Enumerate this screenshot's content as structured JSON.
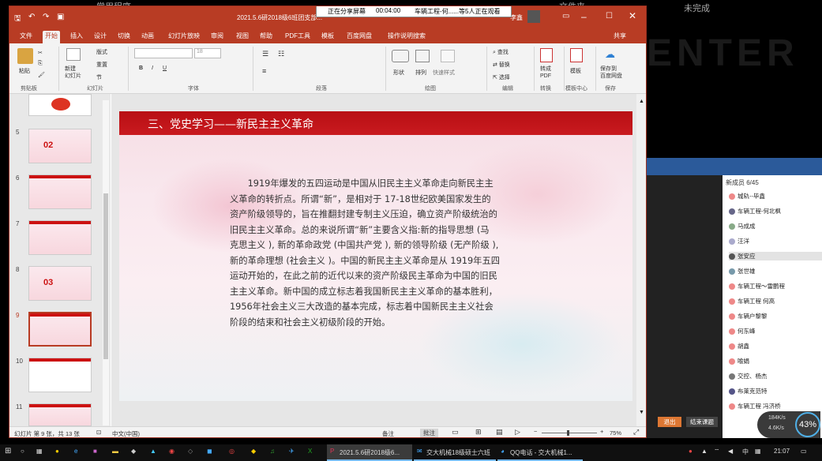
{
  "background": {
    "left_text": "常用程序",
    "mid_text": "文件夹",
    "right_text": "未完成",
    "bg_big": "ENTER"
  },
  "share_bar": {
    "sharing": "正在分享屏幕",
    "time": "00:04:00",
    "viewers": "车辆工程-何......等5人正在观看"
  },
  "ppt": {
    "title": "2021.5.6研2018级6班团支部...",
    "user": "李鑫",
    "tabs": [
      "文件",
      "开始",
      "插入",
      "设计",
      "切换",
      "动画",
      "幻灯片放映",
      "审阅",
      "视图",
      "帮助",
      "PDF工具",
      "模板",
      "百度网盘",
      "操作说明搜索",
      "共享"
    ],
    "ribbon": {
      "paste": "粘贴",
      "new_slide": "新建\n幻灯片",
      "layout": "版式",
      "reset": "重置",
      "section": "节",
      "font_size": "18",
      "groups": [
        "剪贴板",
        "幻灯片",
        "字体",
        "段落",
        "绘图",
        "编辑",
        "转换",
        "模板中心",
        "保存"
      ],
      "shapes": "形状",
      "arrange": "排列",
      "quick_styles": "快速样式",
      "find": "查找",
      "replace": "替换",
      "select": "选择",
      "to_pdf": "转成\nPDF",
      "template": "模板",
      "save_to_baidu": "保存到\n百度网盘"
    },
    "thumbnails": [
      {
        "num": "5",
        "label": "02"
      },
      {
        "num": "6",
        "label": ""
      },
      {
        "num": "7",
        "label": ""
      },
      {
        "num": "8",
        "label": "03"
      },
      {
        "num": "9",
        "label": ""
      },
      {
        "num": "10",
        "label": ""
      },
      {
        "num": "11",
        "label": ""
      }
    ],
    "slide": {
      "header": "三、党史学习——新民主主义革命",
      "lines": [
        "　　1919年爆发的五四运动是中国从旧民主主义革命走向新民主主",
        "义革命的转折点。所谓“新”，是相对于 17-18世纪欧美国家发生的",
        "资产阶级领导的，旨在推翻封建专制主义压迫，确立资产阶级统治的",
        "旧民主主义革命。总的来说所谓“新”主要含义指:新的指导思想 (马",
        "克思主义 ), 新的革命政党 (中国共产党 ), 新的领导阶级 (无产阶级 ),",
        "新的革命理想 (社会主义 )。中国的新民主主义革命是从 1919年五四",
        "运动开始的，在此之前的近代以来的资产阶级民主革命为中国的旧民",
        "主主义革命。新中国的成立标志着我国新民主主义革命的基本胜利，",
        "1956年社会主义三大改造的基本完成，标志着中国新民主主义社会",
        "阶段的结束和社会主义初级阶段的开始。"
      ]
    },
    "status": {
      "slide_info": "幻灯片 第 9 张，共 13 张",
      "lang": "中文(中国)",
      "notes": "备注",
      "comments": "批注",
      "zoom": "75%"
    }
  },
  "meeting": {
    "members_label": "新成员 6/45",
    "members": [
      "城轨--毕鑫",
      "车辆工程-何北枫",
      "马成成",
      "汪洋",
      "张安应",
      "张世雄",
      "车辆工程～雷鹏程",
      "车辆工程  何高",
      "车辆户黎黎",
      "何东峰",
      "胡鑫",
      "喻娟",
      "交控、杨杰",
      "布莱克范特",
      "车辆工程 冯济桥"
    ],
    "btn_exit": "退出",
    "btn_end": "结束课题",
    "speed_up": "184K/s",
    "speed_down": "4.6K/s",
    "cpu": "43%"
  },
  "taskbar": {
    "items": [
      "2021.5.6研2018级6...",
      "交大机械18级硕士六班",
      "QQ电话 - 交大机械1..."
    ],
    "ime": "中",
    "time": "21:07"
  }
}
